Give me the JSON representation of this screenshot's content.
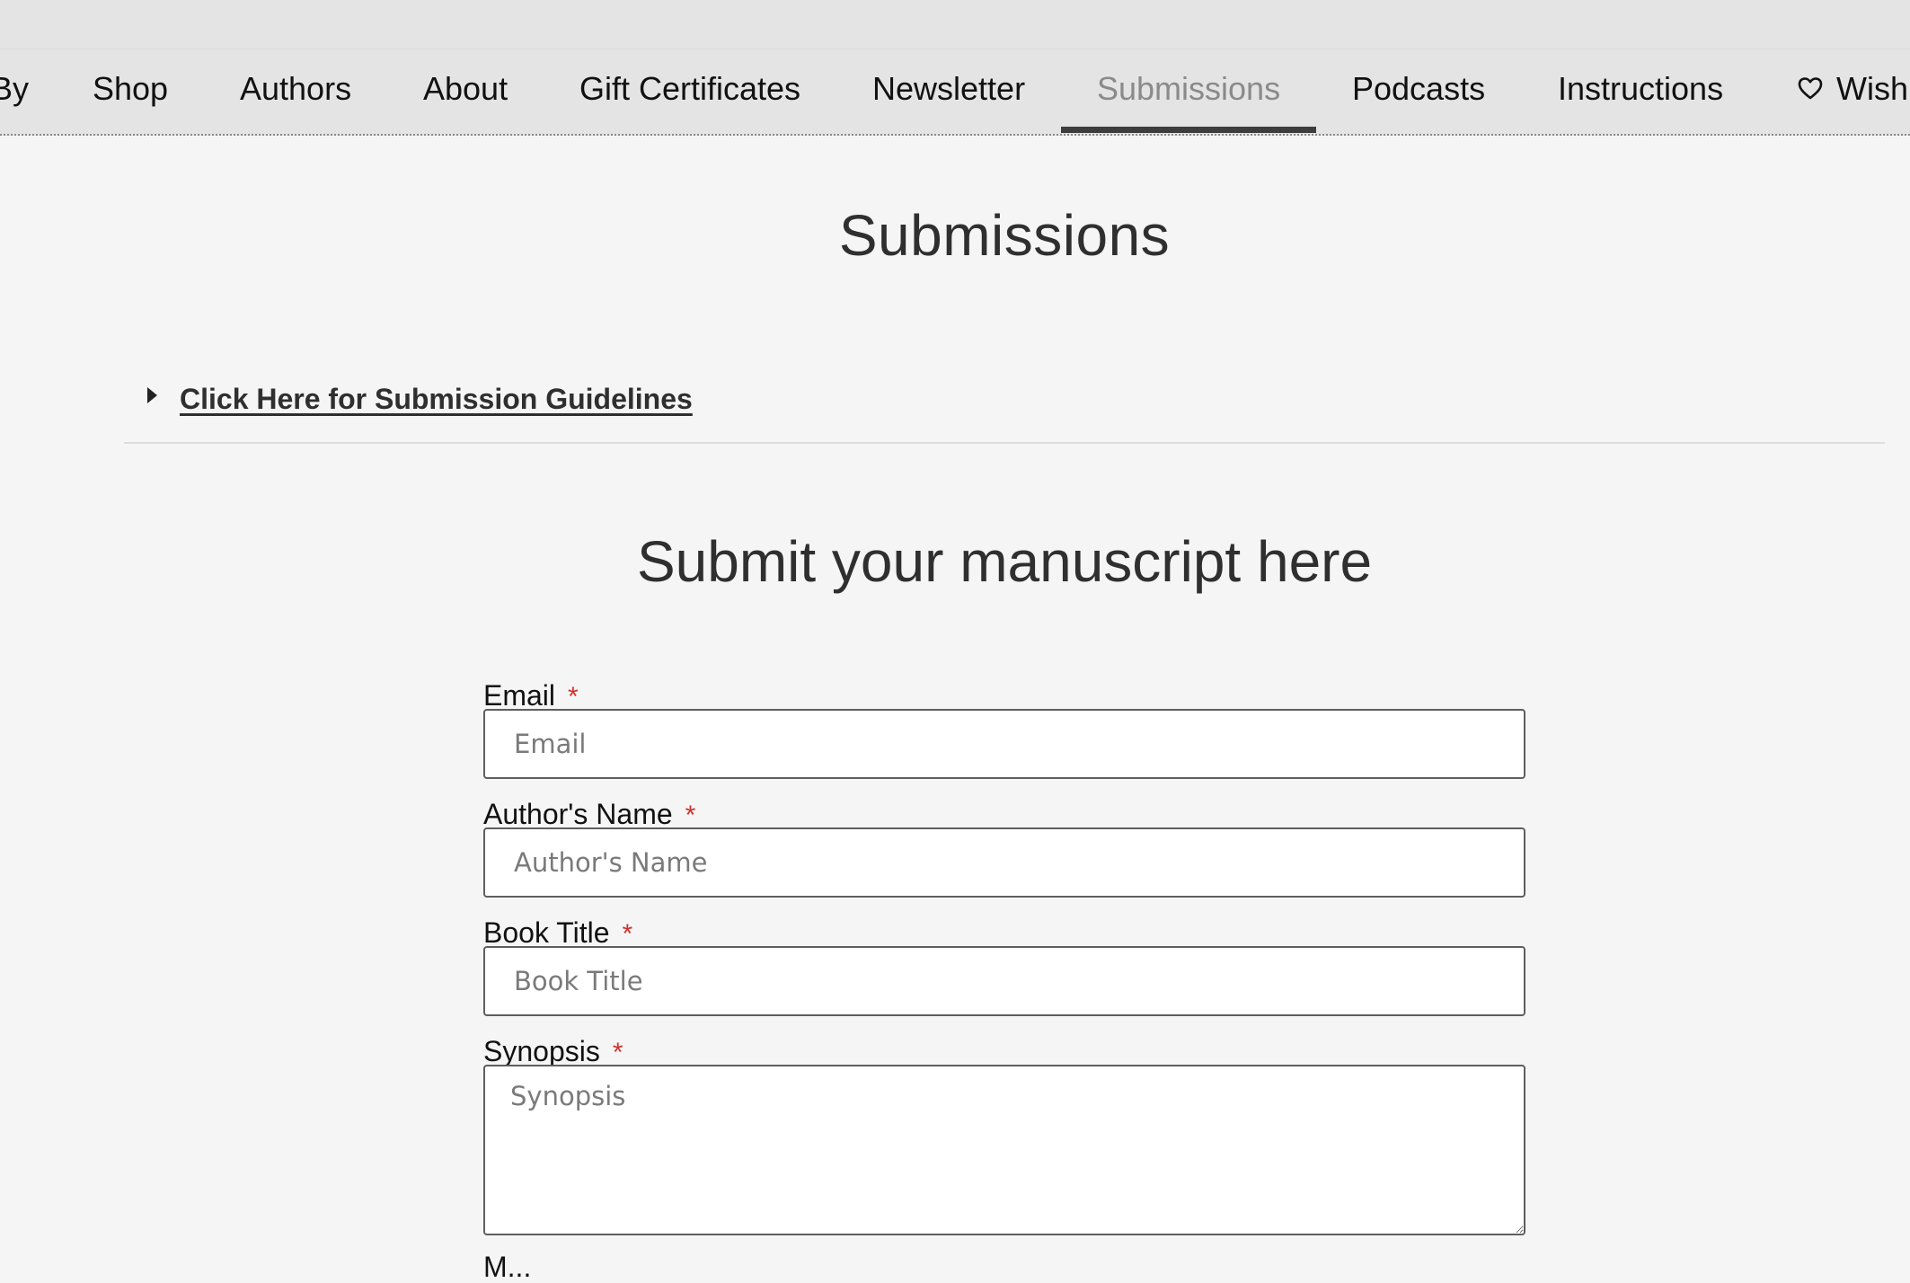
{
  "nav": {
    "items": [
      {
        "label": "By"
      },
      {
        "label": "Shop"
      },
      {
        "label": "Authors"
      },
      {
        "label": "About"
      },
      {
        "label": "Gift Certificates"
      },
      {
        "label": "Newsletter"
      },
      {
        "label": "Submissions",
        "active": true
      },
      {
        "label": "Podcasts"
      },
      {
        "label": "Instructions"
      },
      {
        "label": "Wish",
        "icon": "heart-icon"
      }
    ]
  },
  "page": {
    "title": "Submissions"
  },
  "guidelines": {
    "link_label": "Click Here for Submission Guidelines",
    "toggle_icon": "triangle-right-icon"
  },
  "form": {
    "title": "Submit your manuscript here",
    "required_marker": "*",
    "fields": {
      "email": {
        "label": "Email",
        "placeholder": "Email",
        "value": ""
      },
      "author_name": {
        "label": "Author's Name",
        "placeholder": "Author's Name",
        "value": ""
      },
      "book_title": {
        "label": "Book Title",
        "placeholder": "Book Title",
        "value": ""
      },
      "synopsis": {
        "label": "Synopsis",
        "placeholder": "Synopsis",
        "value": ""
      }
    },
    "next_label_partial": "M..."
  },
  "colors": {
    "background": "#f5f5f5",
    "nav_background": "#e4e4e4",
    "active_nav_text": "#8a8a8a",
    "required_star": "#d0312d",
    "input_border": "#5e5e5e"
  }
}
